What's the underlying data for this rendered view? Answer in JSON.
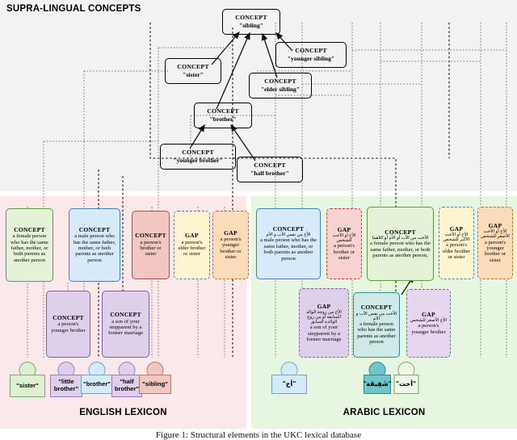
{
  "figure": {
    "caption": "Figure 1: Structural elements in the UKC lexical database"
  },
  "panels": {
    "supra": {
      "title": "SUPRA-LINGUAL CONCEPTS"
    },
    "english": {
      "title": "ENGLISH LEXICON"
    },
    "arabic": {
      "title": "ARABIC LEXICON"
    }
  },
  "supra_nodes": [
    {
      "id": "sibling",
      "hdr": "CONCEPT",
      "label": "\"sibling\"",
      "fill": "#f2c6c2",
      "stroke": "#c0726c"
    },
    {
      "id": "sister",
      "hdr": "CONCEPT",
      "label": "\"sister\"",
      "fill": "#dff0d0",
      "stroke": "#7aa866"
    },
    {
      "id": "younger-sibling",
      "hdr": "CONCEPT",
      "label": "\"younger sibling\"",
      "fill": "#fbdcb8",
      "stroke": "#d79a4e"
    },
    {
      "id": "elder-sibling",
      "hdr": "CONCEPT",
      "label": "\"elder sibling\"",
      "fill": "#fdf5cf",
      "stroke": "#ccb35a"
    },
    {
      "id": "brother",
      "hdr": "CONCEPT",
      "label": "\"brother\"",
      "fill": "#d3eafb",
      "stroke": "#6fa4cc"
    },
    {
      "id": "younger-brother",
      "hdr": "CONCEPT",
      "label": "\"younger brother\"",
      "fill": "#e0d2ec",
      "stroke": "#9c7cb8"
    },
    {
      "id": "half-brother",
      "hdr": "CONCEPT",
      "label": "\"half brother\"",
      "fill": "#e0d2ec",
      "stroke": "#9c7cb8"
    }
  ],
  "english_nodes": [
    {
      "id": "en-sister",
      "hdr": "CONCEPT",
      "kind": "concept",
      "body": "a female person who has the same father, mother, or both parents as another person",
      "fill": "#e4f2d8",
      "stroke": "#5d9b3f"
    },
    {
      "id": "en-brother",
      "hdr": "CONCEPT",
      "kind": "concept",
      "body": "a male person who has the same father, mother, or both parents as another person",
      "fill": "#d7eaf9",
      "stroke": "#3d7fbf"
    },
    {
      "id": "en-sibling",
      "hdr": "CONCEPT",
      "kind": "concept",
      "body": "a person's brother or sister",
      "fill": "#f2c6c2",
      "stroke": "#b94a42"
    },
    {
      "id": "en-gap-elder",
      "hdr": "GAP",
      "kind": "gap",
      "body": "a person's elder brother or sister",
      "fill": "#fdf5cf",
      "stroke": "#3d7fbf"
    },
    {
      "id": "en-gap-younger",
      "hdr": "GAP",
      "kind": "gap",
      "body": "a person's younger brother or sister",
      "fill": "#fbdcb8",
      "stroke": "#c96a1e"
    },
    {
      "id": "en-little-brother",
      "hdr": "CONCEPT",
      "kind": "concept",
      "body": "a person's younger brother",
      "fill": "#ded0eb",
      "stroke": "#7e5fa3"
    },
    {
      "id": "en-half-brother",
      "hdr": "CONCEPT",
      "kind": "concept",
      "body": "a son of your stepparent by a former marriage",
      "fill": "#ded0eb",
      "stroke": "#7e5fa3"
    }
  ],
  "english_lexemes": [
    {
      "id": "lex-sister",
      "word": "\"sister\"",
      "fill": "#dff0d0",
      "stroke": "#7aa866"
    },
    {
      "id": "lex-little-brother",
      "word": "\"little brother\"",
      "fill": "#ded0eb",
      "stroke": "#9c7cb8"
    },
    {
      "id": "lex-brother",
      "word": "\"brother\"",
      "fill": "#d3eafb",
      "stroke": "#6fa4cc"
    },
    {
      "id": "lex-half-brother",
      "word": "\"half brother\"",
      "fill": "#ded0eb",
      "stroke": "#9c7cb8"
    },
    {
      "id": "lex-sibling",
      "word": "\"sibling\"",
      "fill": "#f2c6c2",
      "stroke": "#c0726c"
    }
  ],
  "arabic_nodes": [
    {
      "id": "ar-brother",
      "hdr": "CONCEPT",
      "kind": "concept",
      "ar": "الأخ من نفس الأب و الأم",
      "body": "a male person who has the same father, mother, or both parents as another person",
      "fill": "#d7eaf9",
      "stroke": "#3d7fbf"
    },
    {
      "id": "ar-gap-sibling",
      "hdr": "GAP",
      "kind": "gap",
      "ar": "الأخ أو الأخت للشخص",
      "body": "a person's brother or sister",
      "fill": "#f7d2d0",
      "stroke": "#c0392b"
    },
    {
      "id": "ar-sister",
      "hdr": "CONCEPT",
      "kind": "concept",
      "ar": "الأخت من الأب أو الأم أو كلاهما",
      "body": "a female person who has the same father, mother, or both parents as another person,",
      "fill": "#e4f2d8",
      "stroke": "#5d9b3f"
    },
    {
      "id": "ar-gap-elder",
      "hdr": "GAP",
      "kind": "gap",
      "ar": "الأخ أو الأخت الأكبر للشخص",
      "body": "a person's elder brother or sister",
      "fill": "#fdf5cf",
      "stroke": "#3d7fbf"
    },
    {
      "id": "ar-gap-younger",
      "hdr": "GAP",
      "kind": "gap",
      "ar": "الأخ أو الأخت الأصغر للشخص",
      "body": "a person's younger brother or sister",
      "fill": "#fbdcb8",
      "stroke": "#c96a1e"
    },
    {
      "id": "ar-gap-half",
      "hdr": "GAP",
      "kind": "gap",
      "ar": "الأخ من زوجة الوالد السابقة أو من زوج الوالدة السابق",
      "body": "a son of your stepparent by a former marriage",
      "fill": "#ded0eb",
      "stroke": "#7e5fa3"
    },
    {
      "id": "ar-full-sister",
      "hdr": "CONCEPT",
      "kind": "concept",
      "ar": "الأخت من نفس الأب و الأم",
      "body": "a female person who has the same parents as another person",
      "fill": "#cdeae8",
      "stroke": "#2c8c91"
    },
    {
      "id": "ar-gap-younger-brother",
      "hdr": "GAP",
      "kind": "gap",
      "ar": "الأخ الأصغر للشخص",
      "body": "a person's younger brother",
      "fill": "#e7d6f0",
      "stroke": "#7e5fa3"
    }
  ],
  "arabic_lexemes": [
    {
      "id": "lex-akh",
      "word": "\"أخ\"",
      "fill": "#d3eafb",
      "stroke": "#6fa4cc"
    },
    {
      "id": "lex-shaqiqa",
      "word": "\"شَقِيقَة\"",
      "fill": "#6fc5c8",
      "stroke": "#2c8c91"
    },
    {
      "id": "lex-ukht",
      "word": "\"أخت\"",
      "fill": "#eef7e8",
      "stroke": "#7aa866"
    }
  ]
}
